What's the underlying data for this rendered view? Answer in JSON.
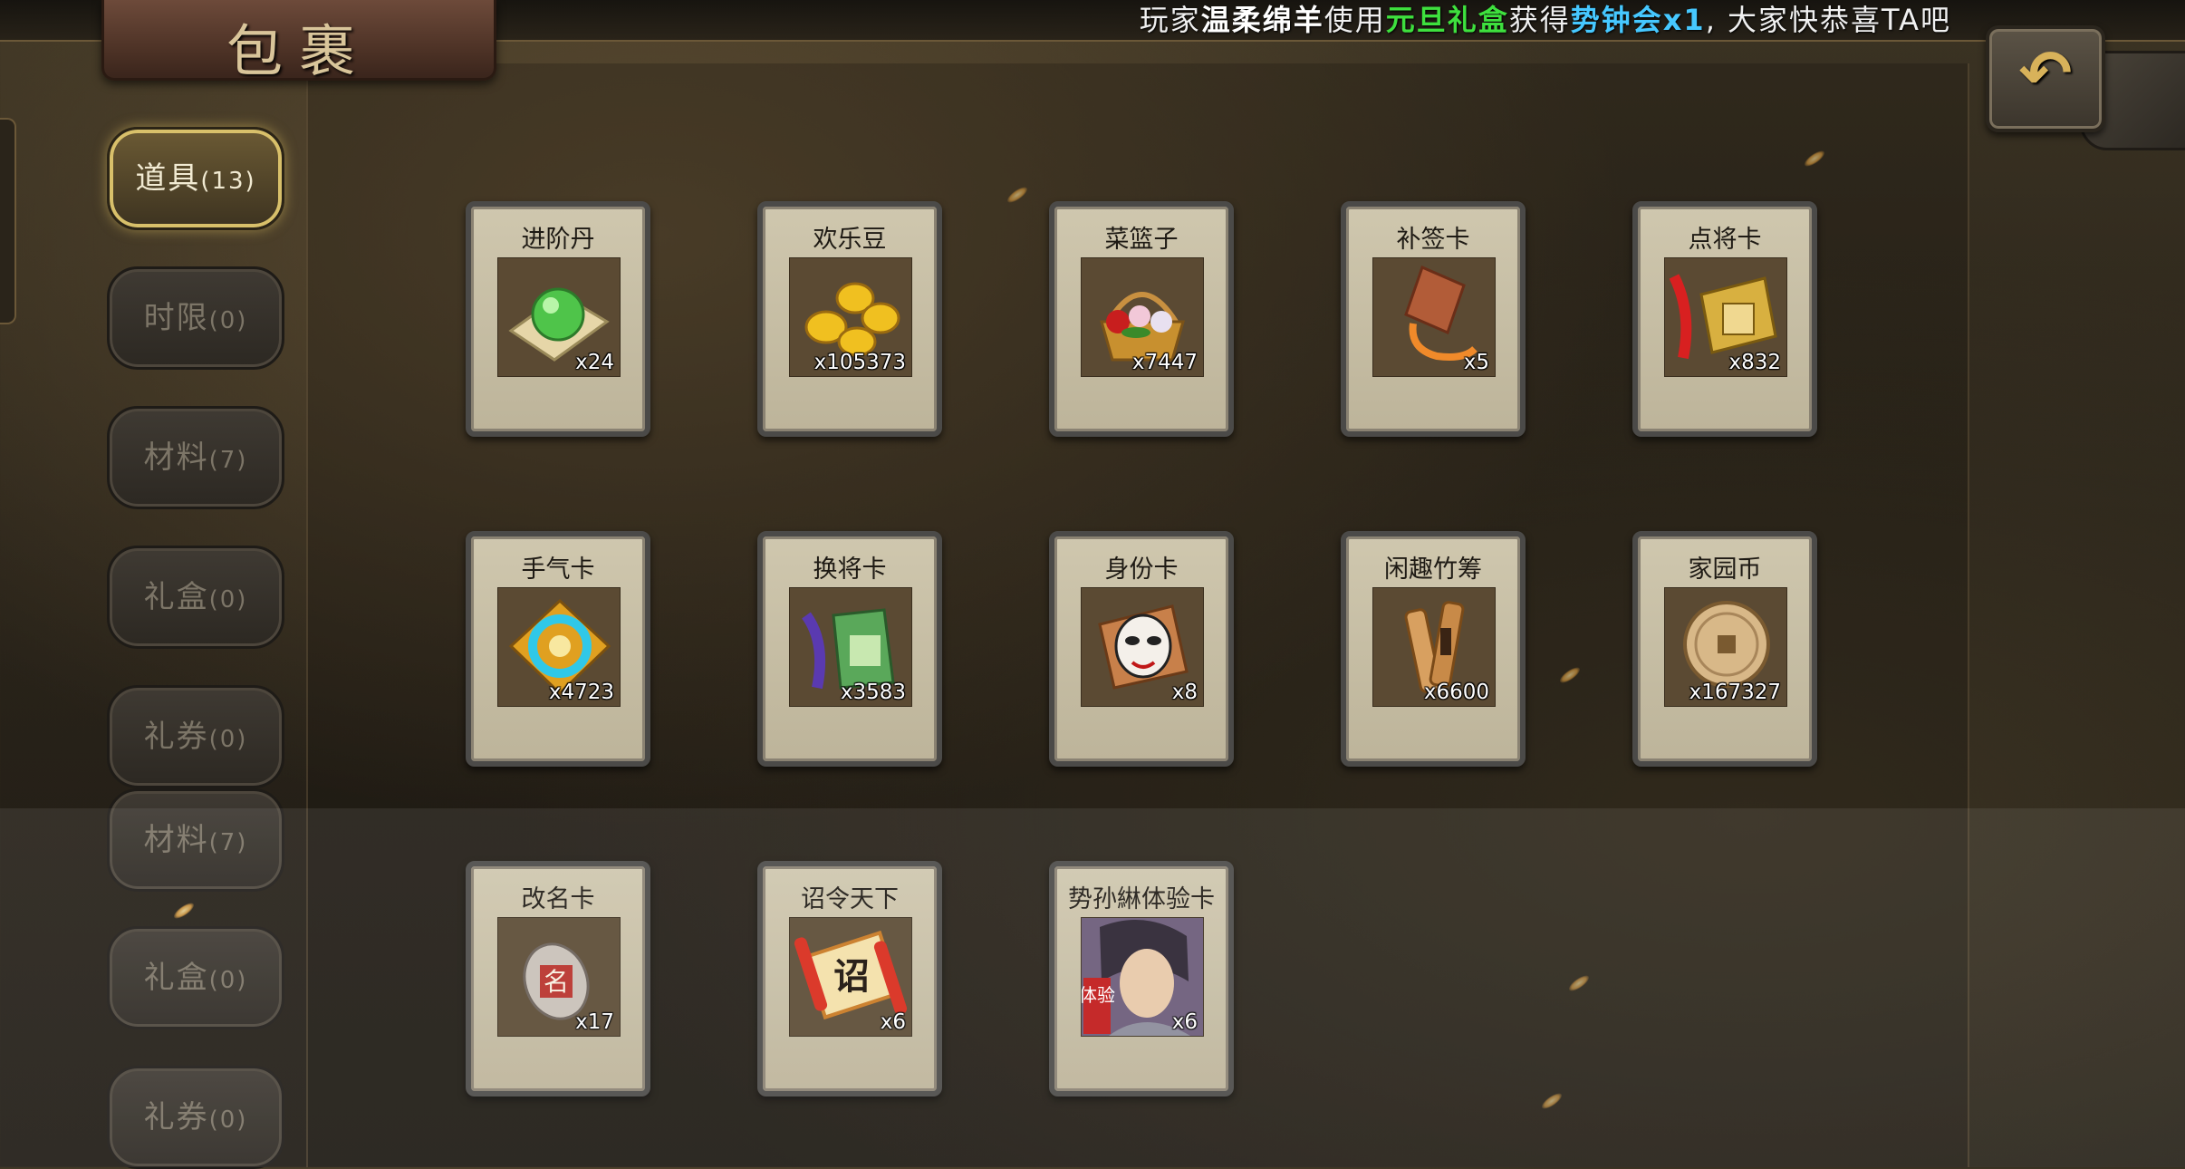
{
  "banner": {
    "prefix": "玩家",
    "player": "温柔绵羊",
    "use": "使用",
    "item": "元旦礼盒",
    "got": "获得",
    "reward": "势钟会x1",
    "suffix": ", 大家快恭喜TA吧"
  },
  "title": "包裹",
  "back_icon": "back-arrow-icon",
  "tabs": [
    {
      "label": "道具",
      "count": "(13)",
      "active": true
    },
    {
      "label": "时限",
      "count": "(0)"
    },
    {
      "label": "材料",
      "count": "(7)"
    },
    {
      "label": "礼盒",
      "count": "(0)"
    },
    {
      "label": "礼券",
      "count": "(0)"
    },
    {
      "label": "材料",
      "count": "(7)"
    },
    {
      "label": "礼盒",
      "count": "(0)"
    },
    {
      "label": "礼券",
      "count": "(0)"
    }
  ],
  "items": [
    {
      "name": "进阶丹",
      "qty": "x24",
      "icon": "green-orb-icon"
    },
    {
      "name": "欢乐豆",
      "qty": "x105373",
      "icon": "gold-beans-icon"
    },
    {
      "name": "菜篮子",
      "qty": "x7447",
      "icon": "flower-basket-icon"
    },
    {
      "name": "补签卡",
      "qty": "x5",
      "icon": "wooden-tag-icon"
    },
    {
      "name": "点将卡",
      "qty": "x832",
      "icon": "general-card-icon"
    },
    {
      "name": "手气卡",
      "qty": "x4723",
      "icon": "luck-card-icon"
    },
    {
      "name": "换将卡",
      "qty": "x3583",
      "icon": "swap-general-icon"
    },
    {
      "name": "身份卡",
      "qty": "x8",
      "icon": "opera-mask-icon"
    },
    {
      "name": "闲趣竹筹",
      "qty": "x6600",
      "icon": "bamboo-token-icon"
    },
    {
      "name": "家园币",
      "qty": "x167327",
      "icon": "home-coin-icon"
    },
    {
      "name": "改名卡",
      "qty": "x17",
      "icon": "rename-tag-icon"
    },
    {
      "name": "诏令天下",
      "qty": "x6",
      "icon": "edict-scroll-icon"
    },
    {
      "name": "势孙綝体验卡",
      "qty": "x6",
      "icon": "hero-portrait-icon"
    }
  ],
  "icon_glyphs": {
    "rename": "名",
    "edict": "诏",
    "trial": "体验"
  },
  "colors": {
    "player_name": "#ffffff",
    "item_name": "#3ee03e",
    "reward_name": "#46c8ff",
    "active_tab_border": "#d8c06a"
  }
}
